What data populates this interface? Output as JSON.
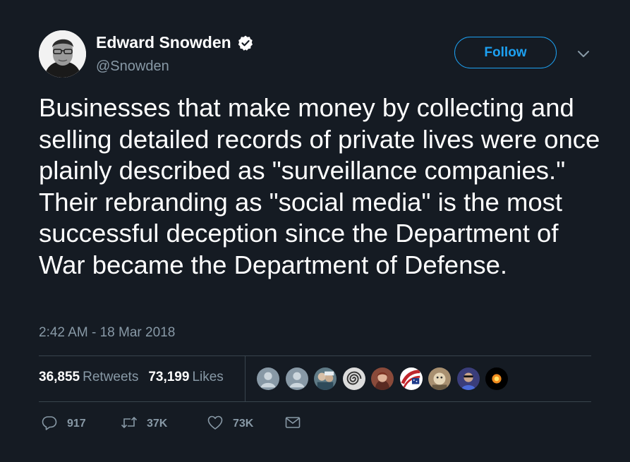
{
  "author": {
    "name": "Edward Snowden",
    "handle": "@Snowden",
    "verified_color": "#ffffff"
  },
  "follow_button": {
    "label": "Follow"
  },
  "menu": {
    "icon": "chevron-down-icon"
  },
  "tweet": {
    "text": "Businesses that make money by collecting and selling detailed records of private lives were once plainly described as \"surveillance companies.\" Their rebranding as \"social media\" is the most successful deception since the Department of War became the Department of Defense.",
    "timestamp": "2:42 AM - 18 Mar 2018"
  },
  "stats": {
    "retweets_count": "36,855",
    "retweets_label": "Retweets",
    "likes_count": "73,199",
    "likes_label": "Likes"
  },
  "likers": [
    {
      "kind": "default-avatar",
      "color": "#8899a6"
    },
    {
      "kind": "default-avatar",
      "color": "#8899a6"
    },
    {
      "kind": "photo",
      "color": "#5f7a86"
    },
    {
      "kind": "spiral",
      "color": "#c8c8c8"
    },
    {
      "kind": "photo",
      "color": "#8a4a3a"
    },
    {
      "kind": "flag",
      "color": "#c0262d"
    },
    {
      "kind": "photo",
      "color": "#a89070"
    },
    {
      "kind": "photo",
      "color": "#3a3d7a"
    },
    {
      "kind": "glow",
      "color": "#f08a1e"
    }
  ],
  "actions": {
    "reply_count": "917",
    "retweet_count": "37K",
    "like_count": "73K"
  },
  "colors": {
    "background": "#151b23",
    "accent": "#1da1f2",
    "muted": "#8899a6",
    "divider": "#38444d"
  }
}
